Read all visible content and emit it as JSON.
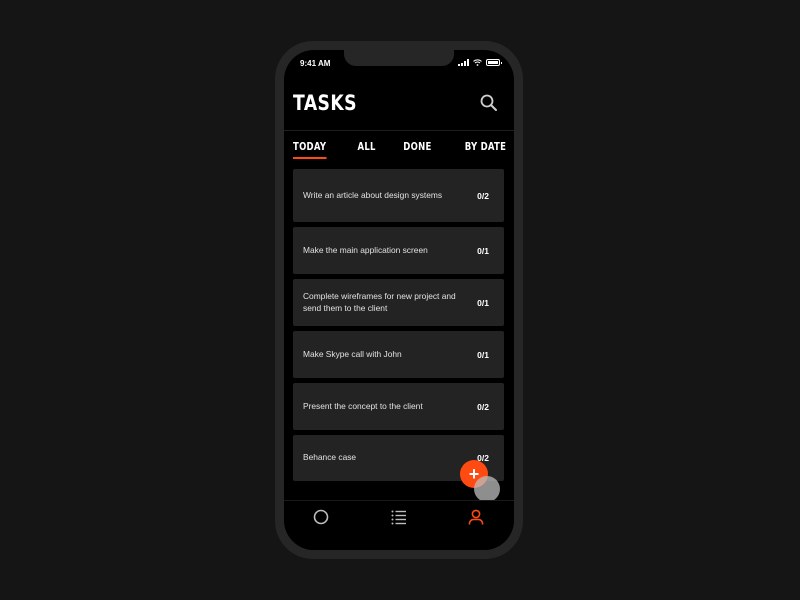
{
  "status_bar": {
    "time": "9:41 AM"
  },
  "header": {
    "title": "TASKS"
  },
  "tabs": [
    {
      "label": "TODAY",
      "active": true
    },
    {
      "label": "ALL",
      "active": false
    },
    {
      "label": "DONE",
      "active": false
    },
    {
      "label": "BY DATE",
      "active": false
    }
  ],
  "tasks": [
    {
      "text": "Write an article about design systems",
      "count": "0/2"
    },
    {
      "text": "Make the main application screen",
      "count": "0/1"
    },
    {
      "text": "Complete wireframes for new project and send them to the client",
      "count": "0/1"
    },
    {
      "text": "Make Skype call with John",
      "count": "0/1"
    },
    {
      "text": "Present the concept to the client",
      "count": "0/2"
    },
    {
      "text": "Behance case",
      "count": "0/2"
    }
  ],
  "fab": {
    "label": "+"
  },
  "colors": {
    "accent": "#ff4b12",
    "card": "#232323",
    "background": "#000000"
  },
  "icons": {
    "search": "search-icon",
    "nav": [
      "circle-icon",
      "list-icon",
      "user-icon"
    ]
  },
  "bottom_nav": {
    "active_index": 2
  }
}
